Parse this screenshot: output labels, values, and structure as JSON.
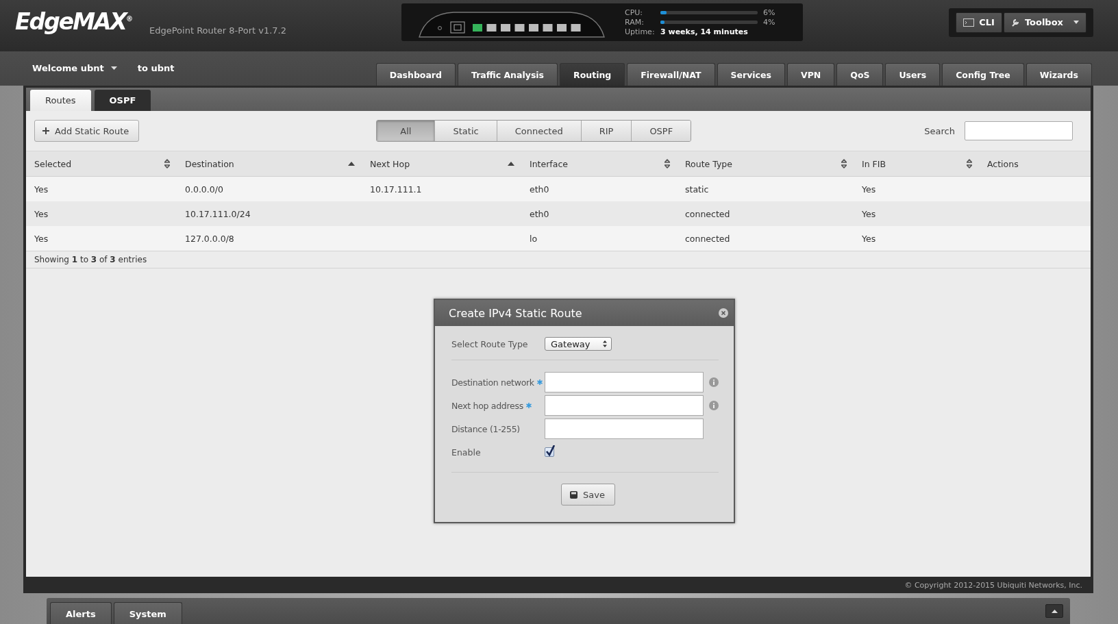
{
  "header": {
    "logo": "EdgeMAX$^{®}$",
    "model": "EdgePoint Router 8-Port v1.7.2",
    "ports": [
      {
        "up": true
      },
      {
        "up": false
      },
      {
        "up": false
      },
      {
        "up": false
      },
      {
        "up": false
      },
      {
        "up": false
      },
      {
        "up": false
      },
      {
        "up": false
      }
    ],
    "meters": [
      {
        "label": "CPU:",
        "level": 0.06,
        "reading": "6%"
      },
      {
        "label": "RAM:",
        "level": 0.04,
        "reading": "4%"
      }
    ],
    "uptime": {
      "label": "Uptime:",
      "value": "3 weeks, 14 minutes"
    },
    "buttons": [
      {
        "kind": "cli",
        "label": "CLI"
      },
      {
        "kind": "toolbox",
        "label": "Toolbox"
      }
    ]
  },
  "user": {
    "welcome": "Welcome ubnt",
    "to": "to ubnt"
  },
  "tabs": [
    {
      "label": "Dashboard",
      "selected": false
    },
    {
      "label": "Traffic Analysis",
      "selected": false
    },
    {
      "label": "Routing",
      "selected": true
    },
    {
      "label": "Firewall/NAT",
      "selected": false
    },
    {
      "label": "Services",
      "selected": false
    },
    {
      "label": "VPN",
      "selected": false
    },
    {
      "label": "QoS",
      "selected": false
    },
    {
      "label": "Users",
      "selected": false
    },
    {
      "label": "Config Tree",
      "selected": false
    },
    {
      "label": "Wizards",
      "selected": false
    }
  ],
  "subtabs": [
    {
      "label": "Routes",
      "selected": true
    },
    {
      "label": "OSPF",
      "selected": false
    }
  ],
  "add_button": "Add Static Route",
  "filters": [
    {
      "label": "All",
      "selected": true
    },
    {
      "label": "Static",
      "selected": false
    },
    {
      "label": "Connected",
      "selected": false
    },
    {
      "label": "RIP",
      "selected": false
    },
    {
      "label": "OSPF",
      "selected": false
    }
  ],
  "search": {
    "label": "Search"
  },
  "table": {
    "columns": [
      {
        "label": "Selected",
        "kind": "sortable"
      },
      {
        "label": "Destination",
        "kind": "ascending"
      },
      {
        "label": "Next Hop",
        "kind": "ascending"
      },
      {
        "label": "Interface",
        "kind": "sortable"
      },
      {
        "label": "Route Type",
        "kind": "sortable"
      },
      {
        "label": "In FIB",
        "kind": "sortable"
      },
      {
        "label": "Actions",
        "kind": "plain"
      }
    ],
    "rows": [
      [
        "Yes",
        "0.0.0.0/0",
        "10.17.111.1",
        "eth0",
        "static",
        "Yes",
        null
      ],
      [
        "Yes",
        "10.17.111.0/24",
        null,
        "eth0",
        "connected",
        "Yes",
        null
      ],
      [
        "Yes",
        "127.0.0.0/8",
        null,
        "lo",
        "connected",
        "Yes",
        null
      ]
    ],
    "summary": "Showing **1** to **3** of **3** entries"
  },
  "copyright": "© Copyright 2012-2015 Ubiquiti Networks, Inc.",
  "dialog": {
    "title": "Create IPv4 Static Route",
    "route_type": {
      "label": "Select Route Type",
      "value": "Gateway"
    },
    "fields": [
      {
        "kind": "text",
        "label": "Destination network",
        "required": true,
        "info": true
      },
      {
        "kind": "text",
        "label": "Next hop address",
        "required": true,
        "info": true
      },
      {
        "kind": "text",
        "label": "Distance (1-255)",
        "required": false,
        "info": false
      },
      {
        "kind": "checkbox",
        "label": "Enable",
        "checked": true
      }
    ],
    "save": "Save"
  },
  "bottom_tabs": [
    "Alerts",
    "System"
  ]
}
